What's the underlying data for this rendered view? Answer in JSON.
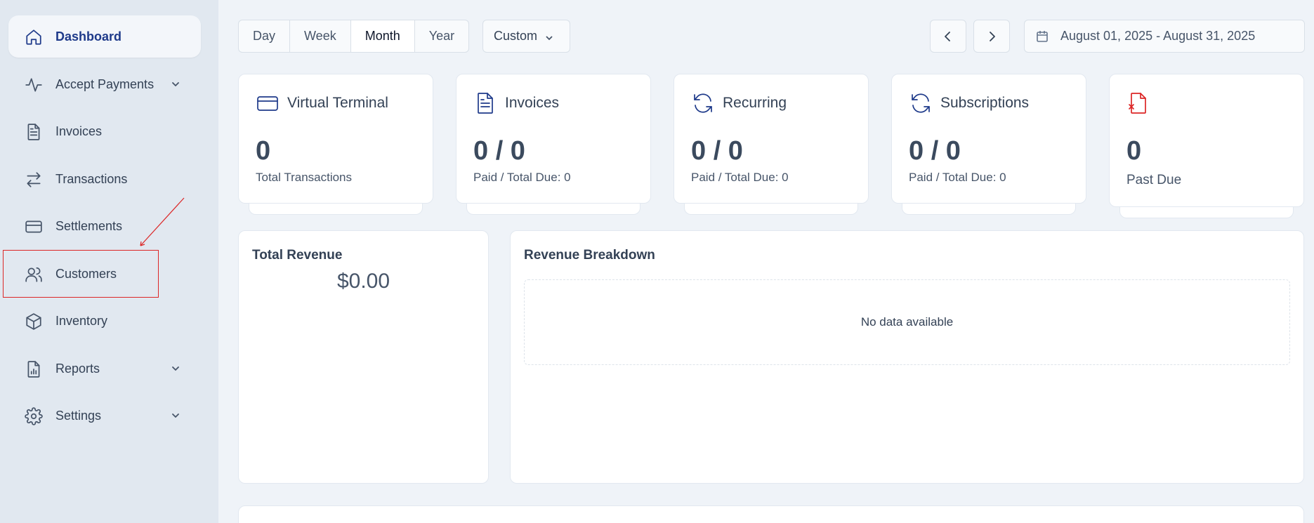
{
  "sidebar": {
    "items": [
      {
        "label": "Dashboard",
        "icon": "home-icon",
        "active": true
      },
      {
        "label": "Accept Payments",
        "icon": "activity-icon",
        "expandable": true
      },
      {
        "label": "Invoices",
        "icon": "document-icon"
      },
      {
        "label": "Transactions",
        "icon": "arrows-swap-icon"
      },
      {
        "label": "Settlements",
        "icon": "credit-card-icon"
      },
      {
        "label": "Customers",
        "icon": "users-icon"
      },
      {
        "label": "Inventory",
        "icon": "box-icon"
      },
      {
        "label": "Reports",
        "icon": "report-icon",
        "expandable": true
      },
      {
        "label": "Settings",
        "icon": "gear-icon",
        "expandable": true
      }
    ]
  },
  "toolbar": {
    "periods": [
      "Day",
      "Week",
      "Month",
      "Year"
    ],
    "active_period": "Month",
    "custom_label": "Custom",
    "date_range": "August 01, 2025 - August 31, 2025"
  },
  "stats": [
    {
      "title": "Virtual Terminal",
      "value": "0",
      "sub": "Total Transactions",
      "icon": "credit-card-icon"
    },
    {
      "title": "Invoices",
      "value": "0 / 0",
      "sub": "Paid / Total Due: 0",
      "icon": "document-icon"
    },
    {
      "title": "Recurring",
      "value": "0 / 0",
      "sub": "Paid / Total Due: 0",
      "icon": "refresh-icon"
    },
    {
      "title": "Subscriptions",
      "value": "0 / 0",
      "sub": "Paid / Total Due: 0",
      "icon": "refresh-icon"
    },
    {
      "title": "",
      "value": "0",
      "sub": "Past Due",
      "icon": "file-x-icon"
    }
  ],
  "total_revenue": {
    "title": "Total Revenue",
    "value": "$0.00"
  },
  "revenue_breakdown": {
    "title": "Revenue Breakdown",
    "empty_text": "No data available"
  },
  "colors": {
    "accent": "#1e3a8a",
    "danger": "#dc2626",
    "annotation": "#dc2626"
  }
}
